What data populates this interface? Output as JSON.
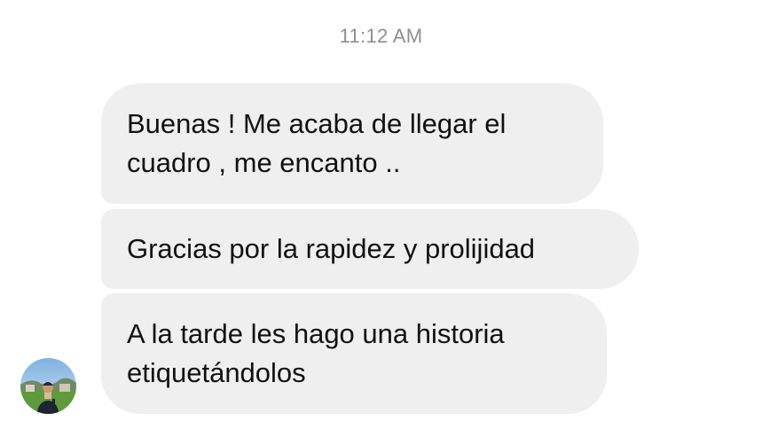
{
  "conversation": {
    "timestamp": "11:12 AM",
    "messages": [
      {
        "lines": [
          "Buenas ! Me acaba de llegar el",
          "cuadro , me encanto .."
        ]
      },
      {
        "lines": [
          "Gracias por la rapidez y prolijidad"
        ]
      },
      {
        "lines": [
          "A la tarde les hago una historia",
          "etiquetándolos"
        ]
      }
    ],
    "sender_avatar": "avatar-photo"
  },
  "colors": {
    "bubble_bg": "#efefef",
    "timestamp_text": "#8e8e93",
    "message_text": "#111111"
  }
}
